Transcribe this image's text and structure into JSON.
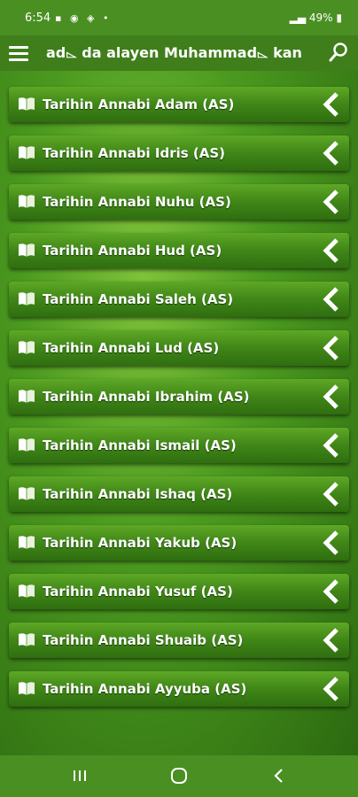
{
  "status_bar": {
    "time": "6:54",
    "battery": "49%"
  },
  "app_bar": {
    "title": "ad⌳ da alayen Muhammad⌳ kan",
    "menu_icon": "hamburger-menu-icon",
    "search_icon": "search-icon"
  },
  "list": {
    "items": [
      {
        "label": "Tarihin Annabi Adam (AS)"
      },
      {
        "label": "Tarihin Annabi Idris (AS)"
      },
      {
        "label": "Tarihin Annabi Nuhu (AS)"
      },
      {
        "label": "Tarihin Annabi Hud (AS)"
      },
      {
        "label": "Tarihin Annabi Saleh (AS)"
      },
      {
        "label": "Tarihin Annabi Lud (AS)"
      },
      {
        "label": "Tarihin Annabi Ibrahim (AS)"
      },
      {
        "label": "Tarihin Annabi Ismail (AS)"
      },
      {
        "label": "Tarihin Annabi Ishaq (AS)"
      },
      {
        "label": "Tarihin Annabi Yakub (AS)"
      },
      {
        "label": "Tarihin Annabi Yusuf (AS)"
      },
      {
        "label": "Tarihin Annabi Shuaib (AS)"
      },
      {
        "label": "Tarihin Annabi Ayyuba (AS)"
      }
    ]
  },
  "colors": {
    "status_bar": "#4a8f22",
    "app_bar": "#3f7e1b",
    "row_top": "#5ea826",
    "row_bottom": "#2f6e10",
    "text": "#ffffff"
  }
}
